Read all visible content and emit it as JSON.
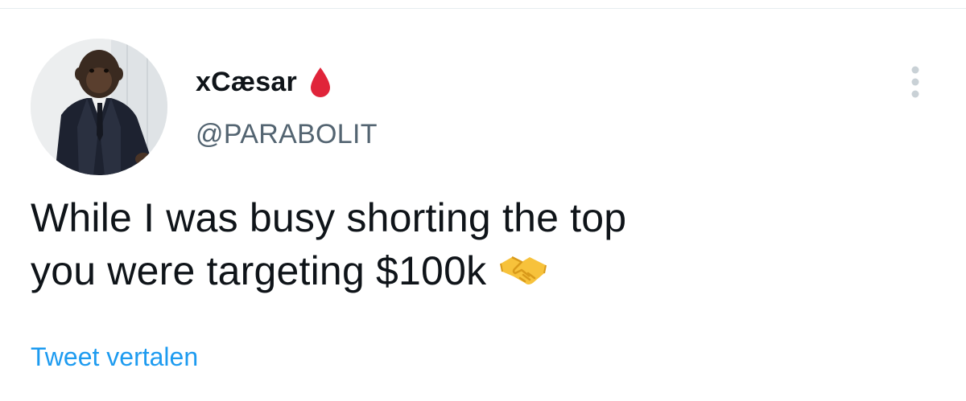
{
  "tweet": {
    "author": {
      "display_name": "xCæsar",
      "name_badge_icon": "blood-drop-icon",
      "handle": "@PARABOLIT",
      "avatar_icon": "avatar-chimp-in-suit"
    },
    "text_line1": "While I was busy shorting the top",
    "text_line2": "you were targeting $100k",
    "text_emoji_icon": "handshake-icon",
    "more_icon": "more-vertical-icon",
    "translate_label": "Tweet vertalen"
  },
  "colors": {
    "text_primary": "#0f1419",
    "text_secondary": "#536471",
    "link": "#1d9bf0",
    "drop": "#e0243a",
    "handshake": "#f7c23b"
  }
}
